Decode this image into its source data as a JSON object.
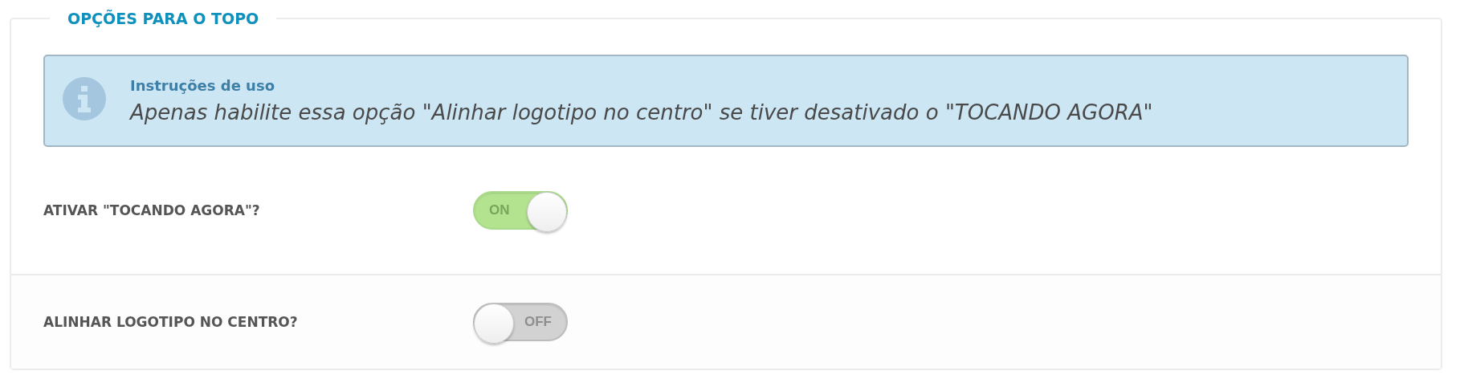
{
  "section": {
    "title": "OPÇÕES PARA O TOPO"
  },
  "info": {
    "title": "Instruções de uso",
    "text": "Apenas habilite essa opção \"Alinhar logotipo no centro\" se tiver desativado o \"TOCANDO AGORA\""
  },
  "options": [
    {
      "label": "ATIVAR \"TOCANDO AGORA\"?",
      "on": true,
      "state_text": "ON"
    },
    {
      "label": "ALINHAR LOGOTIPO NO CENTRO?",
      "on": false,
      "state_text": "OFF"
    }
  ]
}
